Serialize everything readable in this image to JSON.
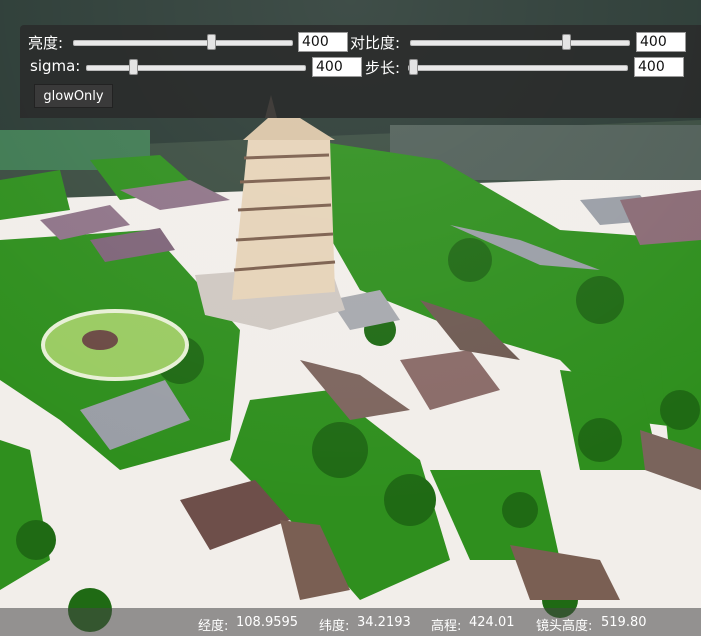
{
  "controls": {
    "brightness": {
      "label": "亮度:",
      "value": "400",
      "level": 0.68
    },
    "contrast": {
      "label": "对比度:",
      "value": "400",
      "level": 0.7
    },
    "sigma": {
      "label": "sigma:",
      "value": "400",
      "level": 0.2
    },
    "step": {
      "label": "步长:",
      "value": "400",
      "level": 0.0
    },
    "glow_button": "glowOnly"
  },
  "status": {
    "lon_label": "经度:",
    "lon_value": "108.9595",
    "lat_label": "纬度:",
    "lat_value": "34.2193",
    "alt_label": "高程:",
    "alt_value": "424.01",
    "cam_label": "镜头高度:",
    "cam_value": "519.80"
  },
  "colors": {
    "panel": "#2a2a2a",
    "vegetation": "#2f8f1e",
    "roof": "#6e5a52",
    "pagoda": "#e6d3b8"
  }
}
